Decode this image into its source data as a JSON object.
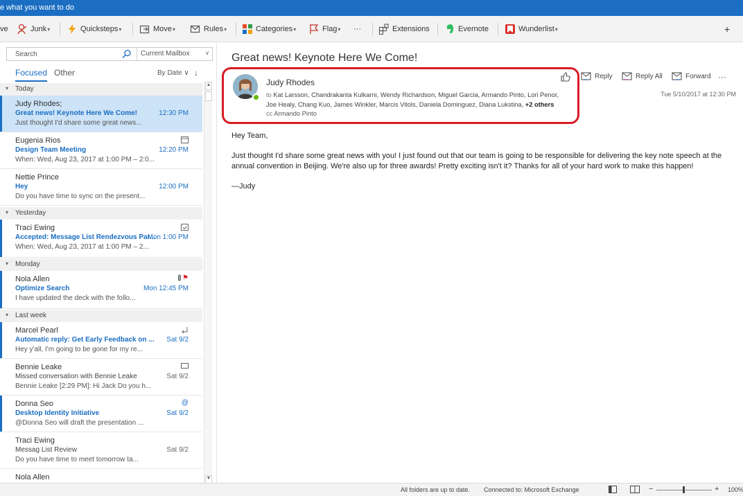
{
  "tell_me": "e what you want to do",
  "ribbon": {
    "archive_fragment": "ve",
    "junk": "Junk",
    "quicksteps": "Quicksteps",
    "move": "Move",
    "rules": "Rules",
    "categories": "Categories",
    "flag": "Flag",
    "more": "···",
    "extensions": "Extensions",
    "evernote": "Evernote",
    "wunderlist": "Wunderlist",
    "plus": "+"
  },
  "search": {
    "placeholder": "Search",
    "scope": "Current Mailbox"
  },
  "tabs": {
    "focused": "Focused",
    "other": "Other",
    "sort": "By Date ∨",
    "sort_arrow": "↓"
  },
  "groups": {
    "today": "Today",
    "yesterday": "Yesterday",
    "monday": "Monday",
    "last_week": "Last week"
  },
  "messages": [
    {
      "sender": "Judy Rhodes;",
      "subject": "Great news! Keynote Here We Come!",
      "preview": "Just thought I'd share some great news...",
      "time": "12:30 PM"
    },
    {
      "sender": "Eugenia Rios",
      "subject": "Design Team Meeting",
      "preview": "When: Wed, Aug 23, 2017 at 1:00 PM – 2:0...",
      "time": "12:20 PM"
    },
    {
      "sender": "Nettie Prince",
      "subject": "Hey",
      "preview": "Do you have time to sync on the present...",
      "time": "12:00 PM"
    },
    {
      "sender": "Traci Ewing",
      "subject": "Accepted: Message List Rendezvous Par...",
      "preview": "When: Wed, Aug 23, 2017 at 1:00 PM – 2...",
      "time": "Mon 1:00 PM"
    },
    {
      "sender": "Nola Allen",
      "subject": "Optimize Search",
      "preview": "I have updated the deck with the follo...",
      "time": "Mon 12:45 PM"
    },
    {
      "sender": "Marcel Pearl",
      "subject": "Automatic reply: Get Early Feedback on ...",
      "preview": "Hey y'all, I'm going to be gone for my re...",
      "time": "Sat 9/2"
    },
    {
      "sender": "Bennie Leake",
      "subject": "Missed conversation with Bennie Leake",
      "preview": "Bennie Leake [2:29 PM]: Hi Jack Do you h...",
      "time": "Sat 9/2"
    },
    {
      "sender": "Donna Seo",
      "subject": "Desktop Identity Initiative",
      "preview": "@Donna Seo will draft the presentation ...",
      "time": "Sat 9/2"
    },
    {
      "sender": "Traci Ewing",
      "subject": "Messag List Review",
      "preview": "Do you have time to meet tomorrow ta...",
      "time": "Sat 9/2"
    },
    {
      "sender": "Nola Allen",
      "subject": "",
      "preview": "",
      "time": ""
    }
  ],
  "mini_icons": {
    "at": "@",
    "flag": "⚑"
  },
  "reading": {
    "title": "Great news! Keynote Here We Come!",
    "from": "Judy Rhodes",
    "to_label": "to",
    "to_line1": "Kat Larsson, Chandrakanta Kulkarni, Wendy Richardson, Miguel Garcia, Armando Pinto, Lori Penor,",
    "to_line2": "Joe Healy, Chang Kuo, James Winkler, Marcis Vitols, Daniela Dominguez, Diana Lukstina,",
    "to_more": "+2 others",
    "cc_label": "cc",
    "cc": "Armando Pinto",
    "reply": "Reply",
    "reply_all": "Reply All",
    "forward": "Forward",
    "more": "···",
    "date": "Tue 5/10/2017 at 12:30 PM",
    "greeting": "Hey Team,",
    "body": "Just thought I'd share some great news with you! I just found out that our team is going to be responsible for delivering the key note speech at the annual convention in Beijing. We're also up for three awards! Pretty exciting isn't it? Thanks for all of your hard work to make this happen!",
    "signature": "—Judy"
  },
  "status": {
    "folders": "All folders are up to date.",
    "connected": "Connected to: Microsoft Exchange",
    "minus": "−",
    "plus": "+",
    "zoom": "100%"
  },
  "colors": {
    "accent": "#1b6ec2",
    "highlight_box": "#d91b24",
    "selected_row": "#cde3f7",
    "presence": "#6bb700"
  }
}
